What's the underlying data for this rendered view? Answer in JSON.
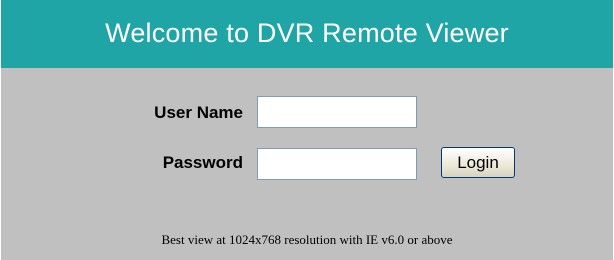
{
  "header": {
    "title": "Welcome to DVR Remote Viewer"
  },
  "login_form": {
    "username_label": "User Name",
    "username_value": "",
    "password_label": "Password",
    "password_value": "",
    "login_button": "Login"
  },
  "footer": {
    "note": "Best view at 1024x768 resolution with IE v6.0 or above"
  },
  "colors": {
    "header_background": "#1fa5a6",
    "panel_background": "#c0c0c0",
    "header_text": "#ffffff"
  }
}
